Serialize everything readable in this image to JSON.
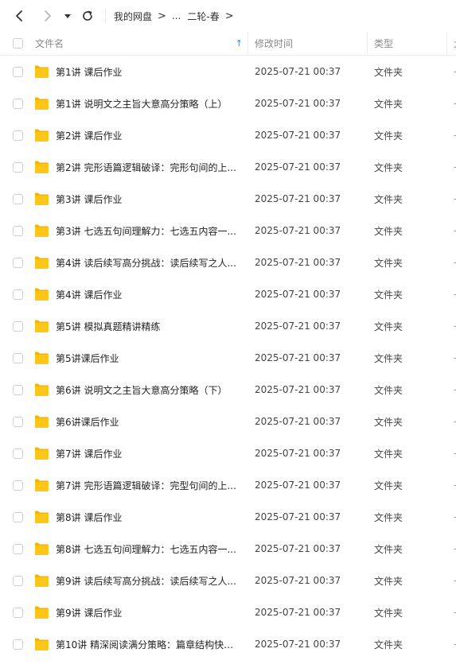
{
  "breadcrumb": {
    "root": "我的网盘",
    "ellipsis": "...",
    "current": "二轮-春"
  },
  "columns": {
    "name": "文件名",
    "date": "修改时间",
    "type": "类型",
    "size": "大"
  },
  "rows": [
    {
      "name": "第1讲 课后作业",
      "date": "2025-07-21 00:37",
      "type": "文件夹",
      "size": "-"
    },
    {
      "name": "第1讲 说明文之主旨大意高分策略（上）",
      "date": "2025-07-21 00:37",
      "type": "文件夹",
      "size": "-"
    },
    {
      "name": "第2讲 课后作业",
      "date": "2025-07-21 00:37",
      "type": "文件夹",
      "size": "-"
    },
    {
      "name": "第2讲 完形语篇逻辑破译：完形句间的上...",
      "date": "2025-07-21 00:37",
      "type": "文件夹",
      "size": "-"
    },
    {
      "name": "第3讲 课后作业",
      "date": "2025-07-21 00:37",
      "type": "文件夹",
      "size": "-"
    },
    {
      "name": "第3讲 七选五句间理解力：七选五内容一...",
      "date": "2025-07-21 00:37",
      "type": "文件夹",
      "size": "-"
    },
    {
      "name": "第4讲 读后续写高分挑战：读后续写之人...",
      "date": "2025-07-21 00:37",
      "type": "文件夹",
      "size": "-"
    },
    {
      "name": "第4讲 课后作业",
      "date": "2025-07-21 00:37",
      "type": "文件夹",
      "size": "-"
    },
    {
      "name": "第5讲 模拟真题精讲精练",
      "date": "2025-07-21 00:37",
      "type": "文件夹",
      "size": "-"
    },
    {
      "name": "第5讲课后作业",
      "date": "2025-07-21 00:37",
      "type": "文件夹",
      "size": "-"
    },
    {
      "name": "第6讲 说明文之主旨大意高分策略（下）",
      "date": "2025-07-21 00:37",
      "type": "文件夹",
      "size": "-"
    },
    {
      "name": "第6讲课后作业",
      "date": "2025-07-21 00:37",
      "type": "文件夹",
      "size": "-"
    },
    {
      "name": "第7讲 课后作业",
      "date": "2025-07-21 00:37",
      "type": "文件夹",
      "size": "-"
    },
    {
      "name": "第7讲 完形语篇逻辑破译：完型句间的上...",
      "date": "2025-07-21 00:37",
      "type": "文件夹",
      "size": "-"
    },
    {
      "name": "第8讲 课后作业",
      "date": "2025-07-21 00:37",
      "type": "文件夹",
      "size": "-"
    },
    {
      "name": "第8讲 七选五句间理解力：七选五内容一...",
      "date": "2025-07-21 00:37",
      "type": "文件夹",
      "size": "-"
    },
    {
      "name": "第9讲 读后续写高分挑战：读后续写之人...",
      "date": "2025-07-21 00:37",
      "type": "文件夹",
      "size": "-"
    },
    {
      "name": "第9讲 课后作业",
      "date": "2025-07-21 00:37",
      "type": "文件夹",
      "size": "-"
    },
    {
      "name": "第10讲 精深阅读满分策略：篇章结构快速...",
      "date": "2025-07-21 00:37",
      "type": "文件夹",
      "size": "-"
    }
  ],
  "icons": {
    "back": "arrow-left-icon",
    "forward": "arrow-right-icon",
    "history": "caret-down-icon",
    "refresh": "refresh-icon",
    "folder": "folder-icon",
    "sort": "sort-ascending-icon"
  },
  "colors": {
    "folder": "#FFC61A",
    "accent": "#3A84F5"
  }
}
